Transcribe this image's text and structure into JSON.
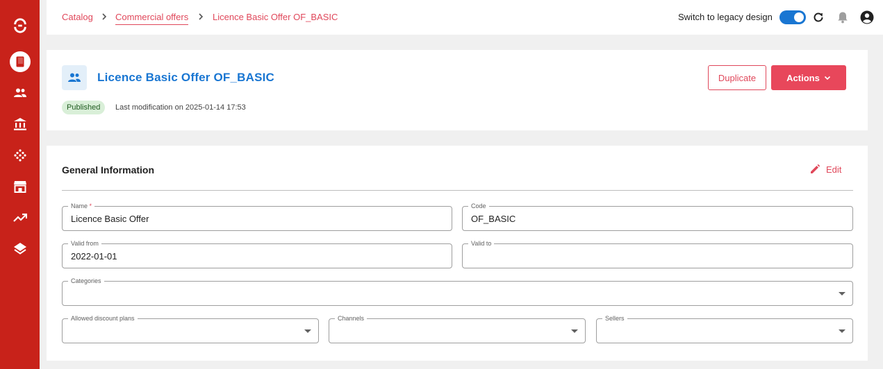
{
  "breadcrumb": {
    "items": [
      {
        "label": "Catalog"
      },
      {
        "label": "Commercial offers"
      },
      {
        "label": "Licence Basic Offer OF_BASIC"
      }
    ]
  },
  "topbar": {
    "legacy_label": "Switch to legacy design",
    "legacy_enabled": true,
    "icons": [
      "refresh-icon",
      "bell-icon",
      "account-icon"
    ]
  },
  "sidebar": {
    "items": [
      {
        "icon": "logo-icon"
      },
      {
        "icon": "catalog-book-icon",
        "active": true
      },
      {
        "icon": "users-icon"
      },
      {
        "icon": "bank-icon"
      },
      {
        "icon": "network-dots-icon"
      },
      {
        "icon": "store-icon"
      },
      {
        "icon": "trending-up-icon"
      },
      {
        "icon": "layers-icon"
      }
    ]
  },
  "offer": {
    "title": "Licence Basic Offer OF_BASIC",
    "status": "Published",
    "last_modification": "Last modification on 2025-01-14 17:53",
    "duplicate_label": "Duplicate",
    "actions_label": "Actions"
  },
  "general": {
    "title": "General Information",
    "edit_label": "Edit",
    "fields": {
      "name": {
        "label": "Name",
        "required_mark": "*",
        "value": "Licence Basic Offer"
      },
      "code": {
        "label": "Code",
        "value": "OF_BASIC"
      },
      "valid_from": {
        "label": "Valid from",
        "value": "2022-01-01"
      },
      "valid_to": {
        "label": "Valid to",
        "value": ""
      },
      "categories": {
        "label": "Categories",
        "value": ""
      },
      "discount_plans": {
        "label": "Allowed discount plans",
        "value": ""
      },
      "channels": {
        "label": "Channels",
        "value": ""
      },
      "sellers": {
        "label": "Sellers",
        "value": ""
      }
    }
  },
  "colors": {
    "sidebar": "#c8221a",
    "accent": "#e0475a",
    "primary": "#1976d2",
    "published_bg": "#d9efd8"
  }
}
